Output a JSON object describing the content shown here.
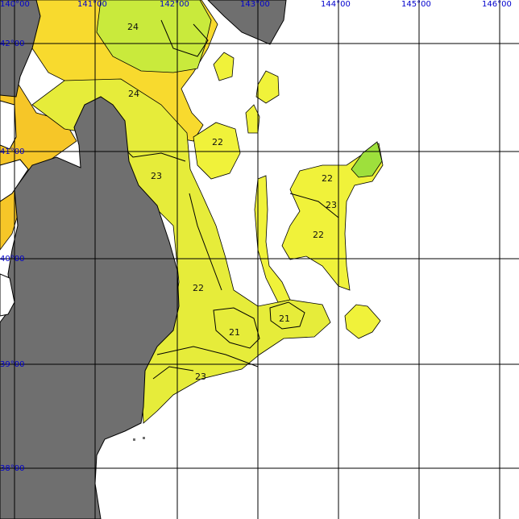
{
  "map": {
    "longitude_labels": [
      "140°00",
      "141°00",
      "142°00",
      "143°00",
      "144°00",
      "145°00",
      "146°00"
    ],
    "latitude_labels": [
      "42°00",
      "41°00",
      "40°00",
      "39°00",
      "38°00"
    ],
    "temperature_labels": [
      "24",
      "24",
      "22",
      "23",
      "22",
      "23",
      "22",
      "22",
      "21",
      "21",
      "23"
    ],
    "colors": {
      "land": "#6f6f6f",
      "t21": "#9ee03c",
      "t22": "#f0f23a",
      "t23": "#e6ec3a",
      "t24": "#f8da2e",
      "t25": "#f6c628",
      "grid": "#000000",
      "label_blue": "#0000cc"
    }
  }
}
